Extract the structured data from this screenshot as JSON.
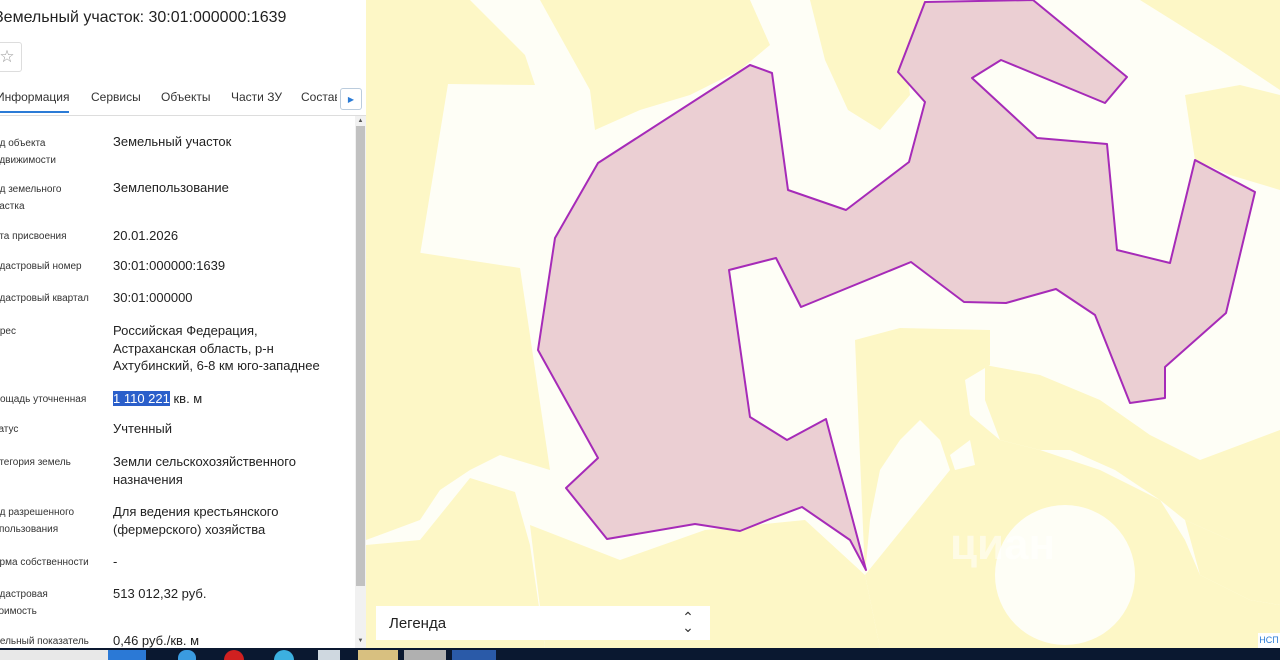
{
  "panel": {
    "title": "Земельный участок: 30:01:000000:1639",
    "favorite_icon": "star-icon",
    "tabs": [
      {
        "label": "Информация",
        "active": true
      },
      {
        "label": "Сервисы",
        "active": false
      },
      {
        "label": "Объекты",
        "active": false
      },
      {
        "label": "Части ЗУ",
        "active": false
      },
      {
        "label": "Состав",
        "active": false
      }
    ],
    "tabs_next_icon": "chevron-right-icon",
    "properties": [
      {
        "label": "ид объекта\nедвижимости",
        "value": "Земельный участок"
      },
      {
        "label": "ид земельного\nчастка",
        "value": "Землепользование"
      },
      {
        "label": "ата присвоения",
        "value": "20.01.2026"
      },
      {
        "label": "адастровый номер",
        "value": "30:01:000000:1639"
      },
      {
        "label": "адастровый квартал",
        "value": "30:01:000000"
      },
      {
        "label": "дрес",
        "value": "Российская Федерация,\nАстраханская область, р-н\nАхтубинский, 6-8 км юго-западнее"
      },
      {
        "label": "лощадь уточненная",
        "value_highlight": "1 110 221",
        "value": " кв. м"
      },
      {
        "label": "татус",
        "value": "Учтенный"
      },
      {
        "label": "атегория земель",
        "value": "Земли сельскохозяйственного\nназначения"
      },
      {
        "label": "ид разрешенного\nспользования",
        "value": "Для ведения крестьянского\n(фермерского) хозяйства"
      },
      {
        "label": "орма собственности",
        "value": "-"
      },
      {
        "label": "адастровая\nтоимость",
        "value": "513 012,32 руб."
      },
      {
        "label": "дельный показатель",
        "value": "0,46 руб./кв. м"
      }
    ]
  },
  "map": {
    "legend_label": "Легенда",
    "legend_toggle_icon": "up-down-chevron-icon",
    "watermark": "циан",
    "corner_text": "НСП",
    "colors": {
      "background": "#fefef6",
      "land_zone": "#fdf7c6",
      "parcel_fill": "#ebcfd3",
      "parcel_stroke": "#a62bb8",
      "selection": "#2b5fca"
    }
  }
}
